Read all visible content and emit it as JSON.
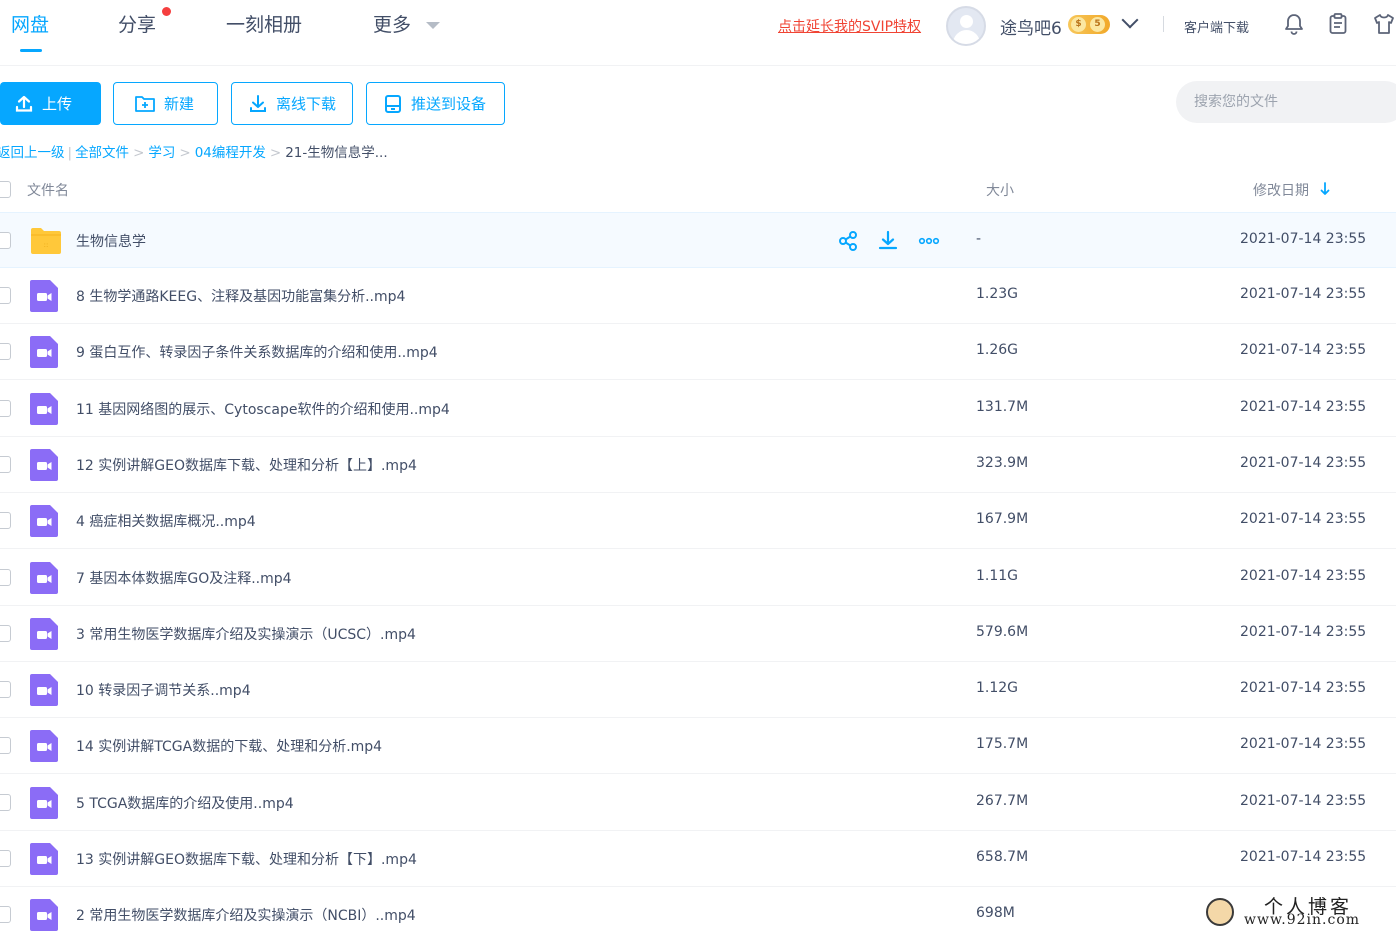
{
  "header": {
    "nav": [
      "网盘",
      "分享",
      "一刻相册",
      "更多"
    ],
    "svip_link": "点击延长我的SVIP特权",
    "username": "途鸟吧6",
    "client_download": "客户端下载"
  },
  "toolbar": {
    "upload": "上传",
    "new": "新建",
    "offline_download": "离线下载",
    "push_to_device": "推送到设备",
    "search_placeholder": "搜索您的文件"
  },
  "breadcrumb": {
    "back": "返回上一级",
    "items": [
      "全部文件",
      "学习",
      "04编程开发"
    ],
    "current": "21-生物信息学..."
  },
  "table": {
    "col_name": "文件名",
    "col_size": "大小",
    "col_date": "修改日期",
    "rows": [
      {
        "type": "folder",
        "name": "生物信息学",
        "size": "-",
        "date": "2021-07-14 23:55"
      },
      {
        "type": "video",
        "name": "8 生物学通路KEEG、注释及基因功能富集分析..mp4",
        "size": "1.23G",
        "date": "2021-07-14 23:55"
      },
      {
        "type": "video",
        "name": "9 蛋白互作、转录因子条件关系数据库的介绍和使用..mp4",
        "size": "1.26G",
        "date": "2021-07-14 23:55"
      },
      {
        "type": "video",
        "name": "11 基因网络图的展示、Cytoscape软件的介绍和使用..mp4",
        "size": "131.7M",
        "date": "2021-07-14 23:55"
      },
      {
        "type": "video",
        "name": "12 实例讲解GEO数据库下载、处理和分析【上】.mp4",
        "size": "323.9M",
        "date": "2021-07-14 23:55"
      },
      {
        "type": "video",
        "name": "4 癌症相关数据库概况..mp4",
        "size": "167.9M",
        "date": "2021-07-14 23:55"
      },
      {
        "type": "video",
        "name": "7 基因本体数据库GO及注释..mp4",
        "size": "1.11G",
        "date": "2021-07-14 23:55"
      },
      {
        "type": "video",
        "name": "3 常用生物医学数据库介绍及实操演示（UCSC）.mp4",
        "size": "579.6M",
        "date": "2021-07-14 23:55"
      },
      {
        "type": "video",
        "name": "10 转录因子调节关系..mp4",
        "size": "1.12G",
        "date": "2021-07-14 23:55"
      },
      {
        "type": "video",
        "name": "14 实例讲解TCGA数据的下载、处理和分析.mp4",
        "size": "175.7M",
        "date": "2021-07-14 23:55"
      },
      {
        "type": "video",
        "name": "5 TCGA数据库的介绍及使用..mp4",
        "size": "267.7M",
        "date": "2021-07-14 23:55"
      },
      {
        "type": "video",
        "name": "13 实例讲解GEO数据库下载、处理和分析【下】.mp4",
        "size": "658.7M",
        "date": "2021-07-14 23:55"
      },
      {
        "type": "video",
        "name": "2 常用生物医学数据库介绍及实操演示（NCBI）..mp4",
        "size": "698M",
        "date": ""
      }
    ]
  },
  "watermark": {
    "line1": "个人博客",
    "line2": "www.92in.com"
  },
  "icons": {
    "folder": "folder-icon",
    "video": "video-file-icon",
    "share": "share-icon",
    "download": "download-icon",
    "more": "more-icon",
    "bell": "bell-icon",
    "clipboard": "clipboard-icon",
    "tshirt": "tshirt-icon"
  },
  "colors": {
    "accent": "#06a7ff",
    "svip_link": "#f04434",
    "video_icon": "#8b6cf6",
    "folder_icon": "#ffc83a"
  }
}
